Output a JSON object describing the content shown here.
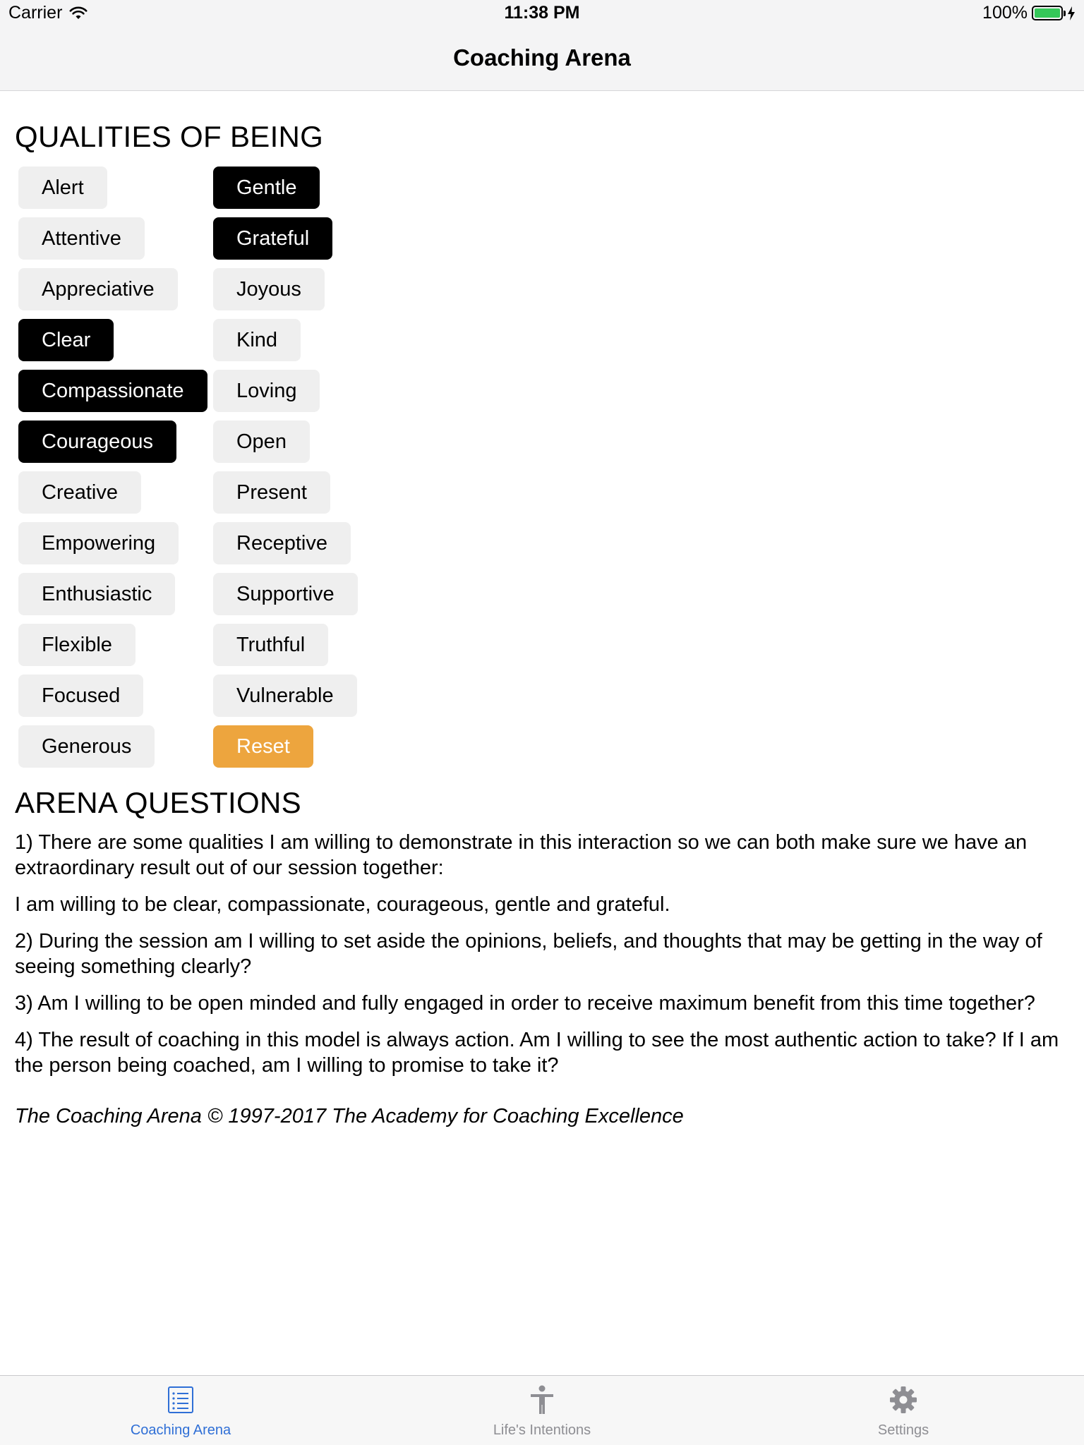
{
  "status_bar": {
    "carrier": "Carrier",
    "time": "11:38 PM",
    "battery": "100%"
  },
  "nav": {
    "title": "Coaching Arena"
  },
  "qualities": {
    "title": "QUALITIES OF BEING",
    "column1": [
      {
        "label": "Alert",
        "selected": false
      },
      {
        "label": "Attentive",
        "selected": false
      },
      {
        "label": "Appreciative",
        "selected": false
      },
      {
        "label": "Clear",
        "selected": true
      },
      {
        "label": "Compassionate",
        "selected": true
      },
      {
        "label": "Courageous",
        "selected": true
      },
      {
        "label": "Creative",
        "selected": false
      },
      {
        "label": "Empowering",
        "selected": false
      },
      {
        "label": "Enthusiastic",
        "selected": false
      },
      {
        "label": "Flexible",
        "selected": false
      },
      {
        "label": "Focused",
        "selected": false
      },
      {
        "label": "Generous",
        "selected": false
      }
    ],
    "column2": [
      {
        "label": "Gentle",
        "selected": true
      },
      {
        "label": "Grateful",
        "selected": true
      },
      {
        "label": "Joyous",
        "selected": false
      },
      {
        "label": "Kind",
        "selected": false
      },
      {
        "label": "Loving",
        "selected": false
      },
      {
        "label": "Open",
        "selected": false
      },
      {
        "label": "Present",
        "selected": false
      },
      {
        "label": "Receptive",
        "selected": false
      },
      {
        "label": "Supportive",
        "selected": false
      },
      {
        "label": "Truthful",
        "selected": false
      },
      {
        "label": "Vulnerable",
        "selected": false
      }
    ],
    "reset_label": "Reset"
  },
  "arena": {
    "title": "ARENA QUESTIONS",
    "paragraphs": [
      "1) There are some qualities I am willing to demonstrate in this interaction so we can both make sure we have an extraordinary result out of our session together:",
      "I am willing to be clear, compassionate, courageous, gentle and grateful.",
      "2) During the session am I willing to set aside the opinions, beliefs, and thoughts that may be getting in the way of seeing something clearly?",
      "3) Am I willing to be open minded and fully engaged in order to receive maximum benefit from this time together?",
      "4) The result of coaching in this model is always action. Am I willing to see the most authentic action to take? If I am the person being coached, am I willing to promise to take it?"
    ],
    "copyright": "The Coaching Arena © 1997-2017 The Academy for Coaching Excellence"
  },
  "tabs": [
    {
      "label": "Coaching Arena",
      "icon": "list-icon",
      "active": true
    },
    {
      "label": "Life's Intentions",
      "icon": "person-icon",
      "active": false
    },
    {
      "label": "Settings",
      "icon": "gear-icon",
      "active": false
    }
  ],
  "colors": {
    "selected_chip": "#000000",
    "unselected_chip": "#efefef",
    "reset_chip": "#eda53e",
    "tab_active": "#2f6fd6",
    "tab_inactive": "#8e8e93",
    "battery": "#35c759"
  }
}
